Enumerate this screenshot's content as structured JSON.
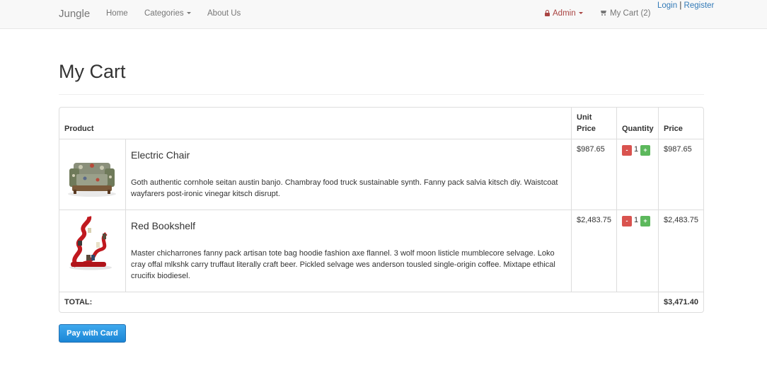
{
  "navbar": {
    "brand": "Jungle",
    "links": [
      "Home",
      "Categories",
      "About Us"
    ],
    "admin_label": "Admin",
    "cart_label": "My Cart (2)",
    "login_label": "Login",
    "separator": "|",
    "register_label": "Register"
  },
  "page": {
    "title": "My Cart"
  },
  "table": {
    "headers": {
      "product": "Product",
      "unit_price": "Unit\nPrice",
      "quantity": "Quantity",
      "price": "Price"
    },
    "rows": [
      {
        "name": "Electric Chair",
        "description": "Goth authentic cornhole seitan austin banjo. Chambray food truck sustainable synth. Fanny pack salvia kitsch diy. Waistcoat wayfarers post-ironic vinegar kitsch disrupt.",
        "unit_price": "$987.65",
        "quantity": "1",
        "price": "$987.65"
      },
      {
        "name": "Red Bookshelf",
        "description": "Master chicharrones fanny pack artisan tote bag hoodie fashion axe flannel. 3 wolf moon listicle mumblecore selvage. Loko cray offal mlkshk carry truffaut literally craft beer. Pickled selvage wes anderson tousled single-origin coffee. Mixtape ethical crucifix biodiesel.",
        "unit_price": "$2,483.75",
        "quantity": "1",
        "price": "$2,483.75"
      }
    ],
    "total_label": "TOTAL:",
    "total_value": "$3,471.40",
    "minus_label": "-",
    "plus_label": "+"
  },
  "pay_button": "Pay with Card",
  "colors": {
    "accent": "#337ab7",
    "danger": "#d9534f",
    "success": "#5cb85c",
    "admin": "#a94442"
  }
}
